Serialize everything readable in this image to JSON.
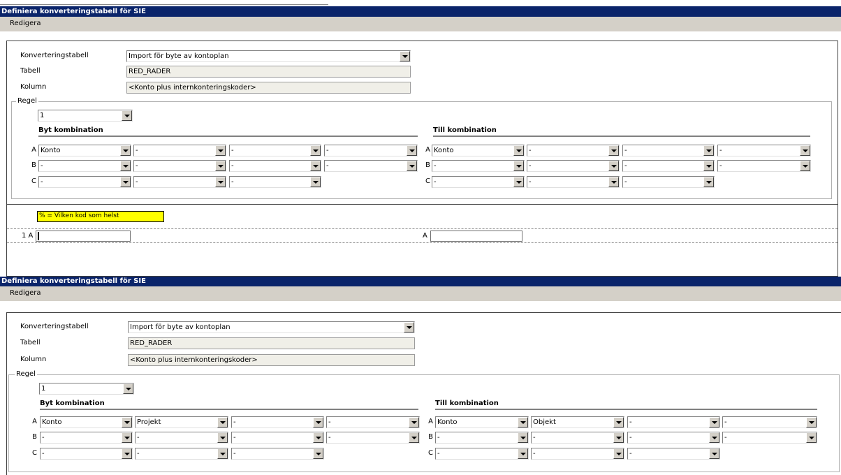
{
  "window1": {
    "title": "Definiera konverteringstabell för SIE",
    "menu": "Redigera",
    "konverteringstabell_label": "Konverteringstabell",
    "konverteringstabell_value": "Import för byte av kontoplan",
    "tabell_label": "Tabell",
    "tabell_value": "RED_RADER",
    "kolumn_label": "Kolumn",
    "kolumn_value": "<Konto plus internkonteringskoder>",
    "regel_label": "Regel",
    "regel_value": "1",
    "byt_heading": "Byt kombination",
    "till_heading": "Till kombination",
    "row_labels": [
      "A",
      "B",
      "C"
    ],
    "byt": {
      "A": [
        "Konto",
        "-",
        "-",
        "-"
      ],
      "B": [
        "-",
        "-",
        "-",
        "-"
      ],
      "C": [
        "-",
        "-",
        "-"
      ]
    },
    "till": {
      "A": [
        "Konto",
        "-",
        "-",
        "-"
      ],
      "B": [
        "-",
        "-",
        "-",
        "-"
      ],
      "C": [
        "-",
        "-",
        "-"
      ]
    },
    "hint": "% = Vilken kod som helst",
    "row_left_label": "1 A",
    "row_right_label": "A"
  },
  "window2": {
    "title": "Definiera konverteringstabell för SIE",
    "menu": "Redigera",
    "konverteringstabell_label": "Konverteringstabell",
    "konverteringstabell_value": "Import för byte av kontoplan",
    "tabell_label": "Tabell",
    "tabell_value": "RED_RADER",
    "kolumn_label": "Kolumn",
    "kolumn_value": "<Konto plus internkonteringskoder>",
    "regel_label": "Regel",
    "regel_value": "1",
    "byt_heading": "Byt kombination",
    "till_heading": "Till kombination",
    "row_labels": [
      "A",
      "B",
      "C"
    ],
    "byt": {
      "A": [
        "Konto",
        "Projekt",
        "-",
        "-"
      ],
      "B": [
        "-",
        "-",
        "-",
        "-"
      ],
      "C": [
        "-",
        "-",
        "-"
      ]
    },
    "till": {
      "A": [
        "Konto",
        "Objekt",
        "-",
        "-"
      ],
      "B": [
        "-",
        "-",
        "-",
        "-"
      ],
      "C": [
        "-",
        "-",
        "-"
      ]
    }
  },
  "colors": {
    "titlebar": "#0a246a",
    "menubar": "#d4d0c8",
    "hint": "#ffff00"
  }
}
